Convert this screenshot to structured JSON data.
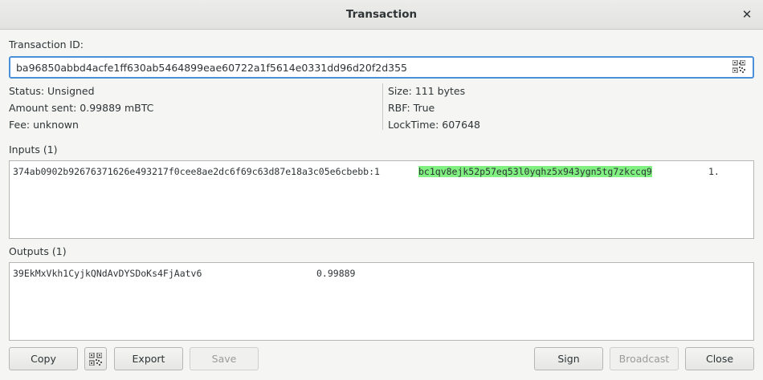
{
  "window": {
    "title": "Transaction"
  },
  "txid": {
    "label": "Transaction ID:",
    "value": "ba96850abbd4acfe1ff630ab5464899eae60722a1f5614e0331dd96d20f2d355"
  },
  "info_left": {
    "status": "Status: Unsigned",
    "amount": "Amount sent: 0.99889 mBTC",
    "fee": "Fee: unknown"
  },
  "info_right": {
    "size": "Size: 111 bytes",
    "rbf": "RBF: True",
    "locktime": "LockTime: 607648"
  },
  "inputs": {
    "label": "Inputs (1)",
    "rows": [
      {
        "prevout": "374ab0902b92676371626e493217f0cee8ae2dc6f69c63d87e18a3c05e6cbebb:1",
        "address": "bc1qv8ejk52p57eq53l0yqhz5x943ygn5tg7zkccq9",
        "amount": "1."
      }
    ]
  },
  "outputs": {
    "label": "Outputs (1)",
    "rows": [
      {
        "address": "39EkMxVkh1CyjkQNdAvDYSDoKs4FjAatv6",
        "amount": "0.99889"
      }
    ]
  },
  "buttons": {
    "copy": "Copy",
    "export": "Export",
    "save": "Save",
    "sign": "Sign",
    "broadcast": "Broadcast",
    "close": "Close"
  },
  "colors": {
    "focus_border": "#4a90d9",
    "address_highlight": "#80f080"
  }
}
